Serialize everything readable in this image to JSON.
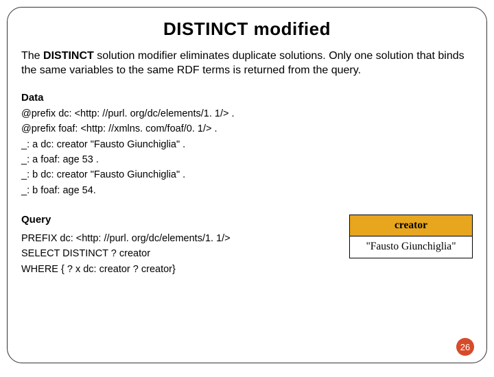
{
  "title": "DISTINCT modified",
  "intro_prefix": "The ",
  "intro_keyword": "DISTINCT",
  "intro_rest": " solution modifier eliminates duplicate solutions. Only one solution that binds the same variables to the same RDF terms is returned from the query.",
  "data_label": "Data",
  "data_lines": [
    "@prefix dc:   <http: //purl. org/dc/elements/1. 1/> .",
    "@prefix foaf: <http: //xmlns. com/foaf/0. 1/> .",
    "_: a dc: creator \"Fausto Giunchiglia\" .",
    "_: a foaf: age 53 .",
    "_: b dc: creator \"Fausto Giunchiglia\" .",
    "_: b foaf: age 54."
  ],
  "query_label": "Query",
  "query_lines": [
    "PREFIX  dc:  <http: //purl. org/dc/elements/1. 1/>",
    "SELECT DISTINCT ? creator",
    " WHERE { ? x dc: creator ? creator}"
  ],
  "result": {
    "header": "creator",
    "cell": "\"Fausto Giunchiglia\""
  },
  "page_number": "26"
}
